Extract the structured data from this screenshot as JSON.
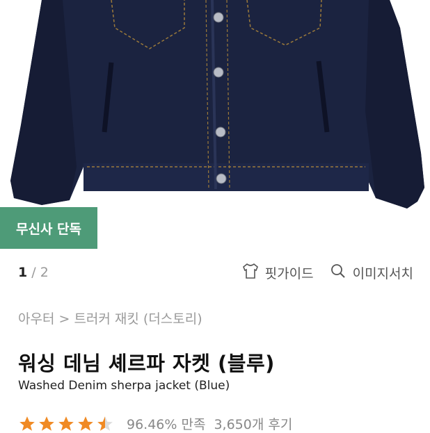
{
  "product_image": {
    "alt": ""
  },
  "badge": {
    "label": "무신사 단독"
  },
  "gallery": {
    "current": "1",
    "separator": "/",
    "total": "2"
  },
  "tools": {
    "fit_guide_label": "핏가이드",
    "image_search_label": "이미지서치"
  },
  "breadcrumb": {
    "text": "아우터 > 트러커 재킷 (더스토리)"
  },
  "product": {
    "title_ko": "워싱 데님 셰르파 자켓 (블루)",
    "title_en": "Washed Denim sherpa jacket (Blue)"
  },
  "rating": {
    "stars": 4.5,
    "satisfaction": "96.46% 만족",
    "reviews": "3,650개 후기",
    "star_color": "#f08a24"
  },
  "colors": {
    "badge_bg": "#4e9b78",
    "denim": "#1b2340"
  }
}
